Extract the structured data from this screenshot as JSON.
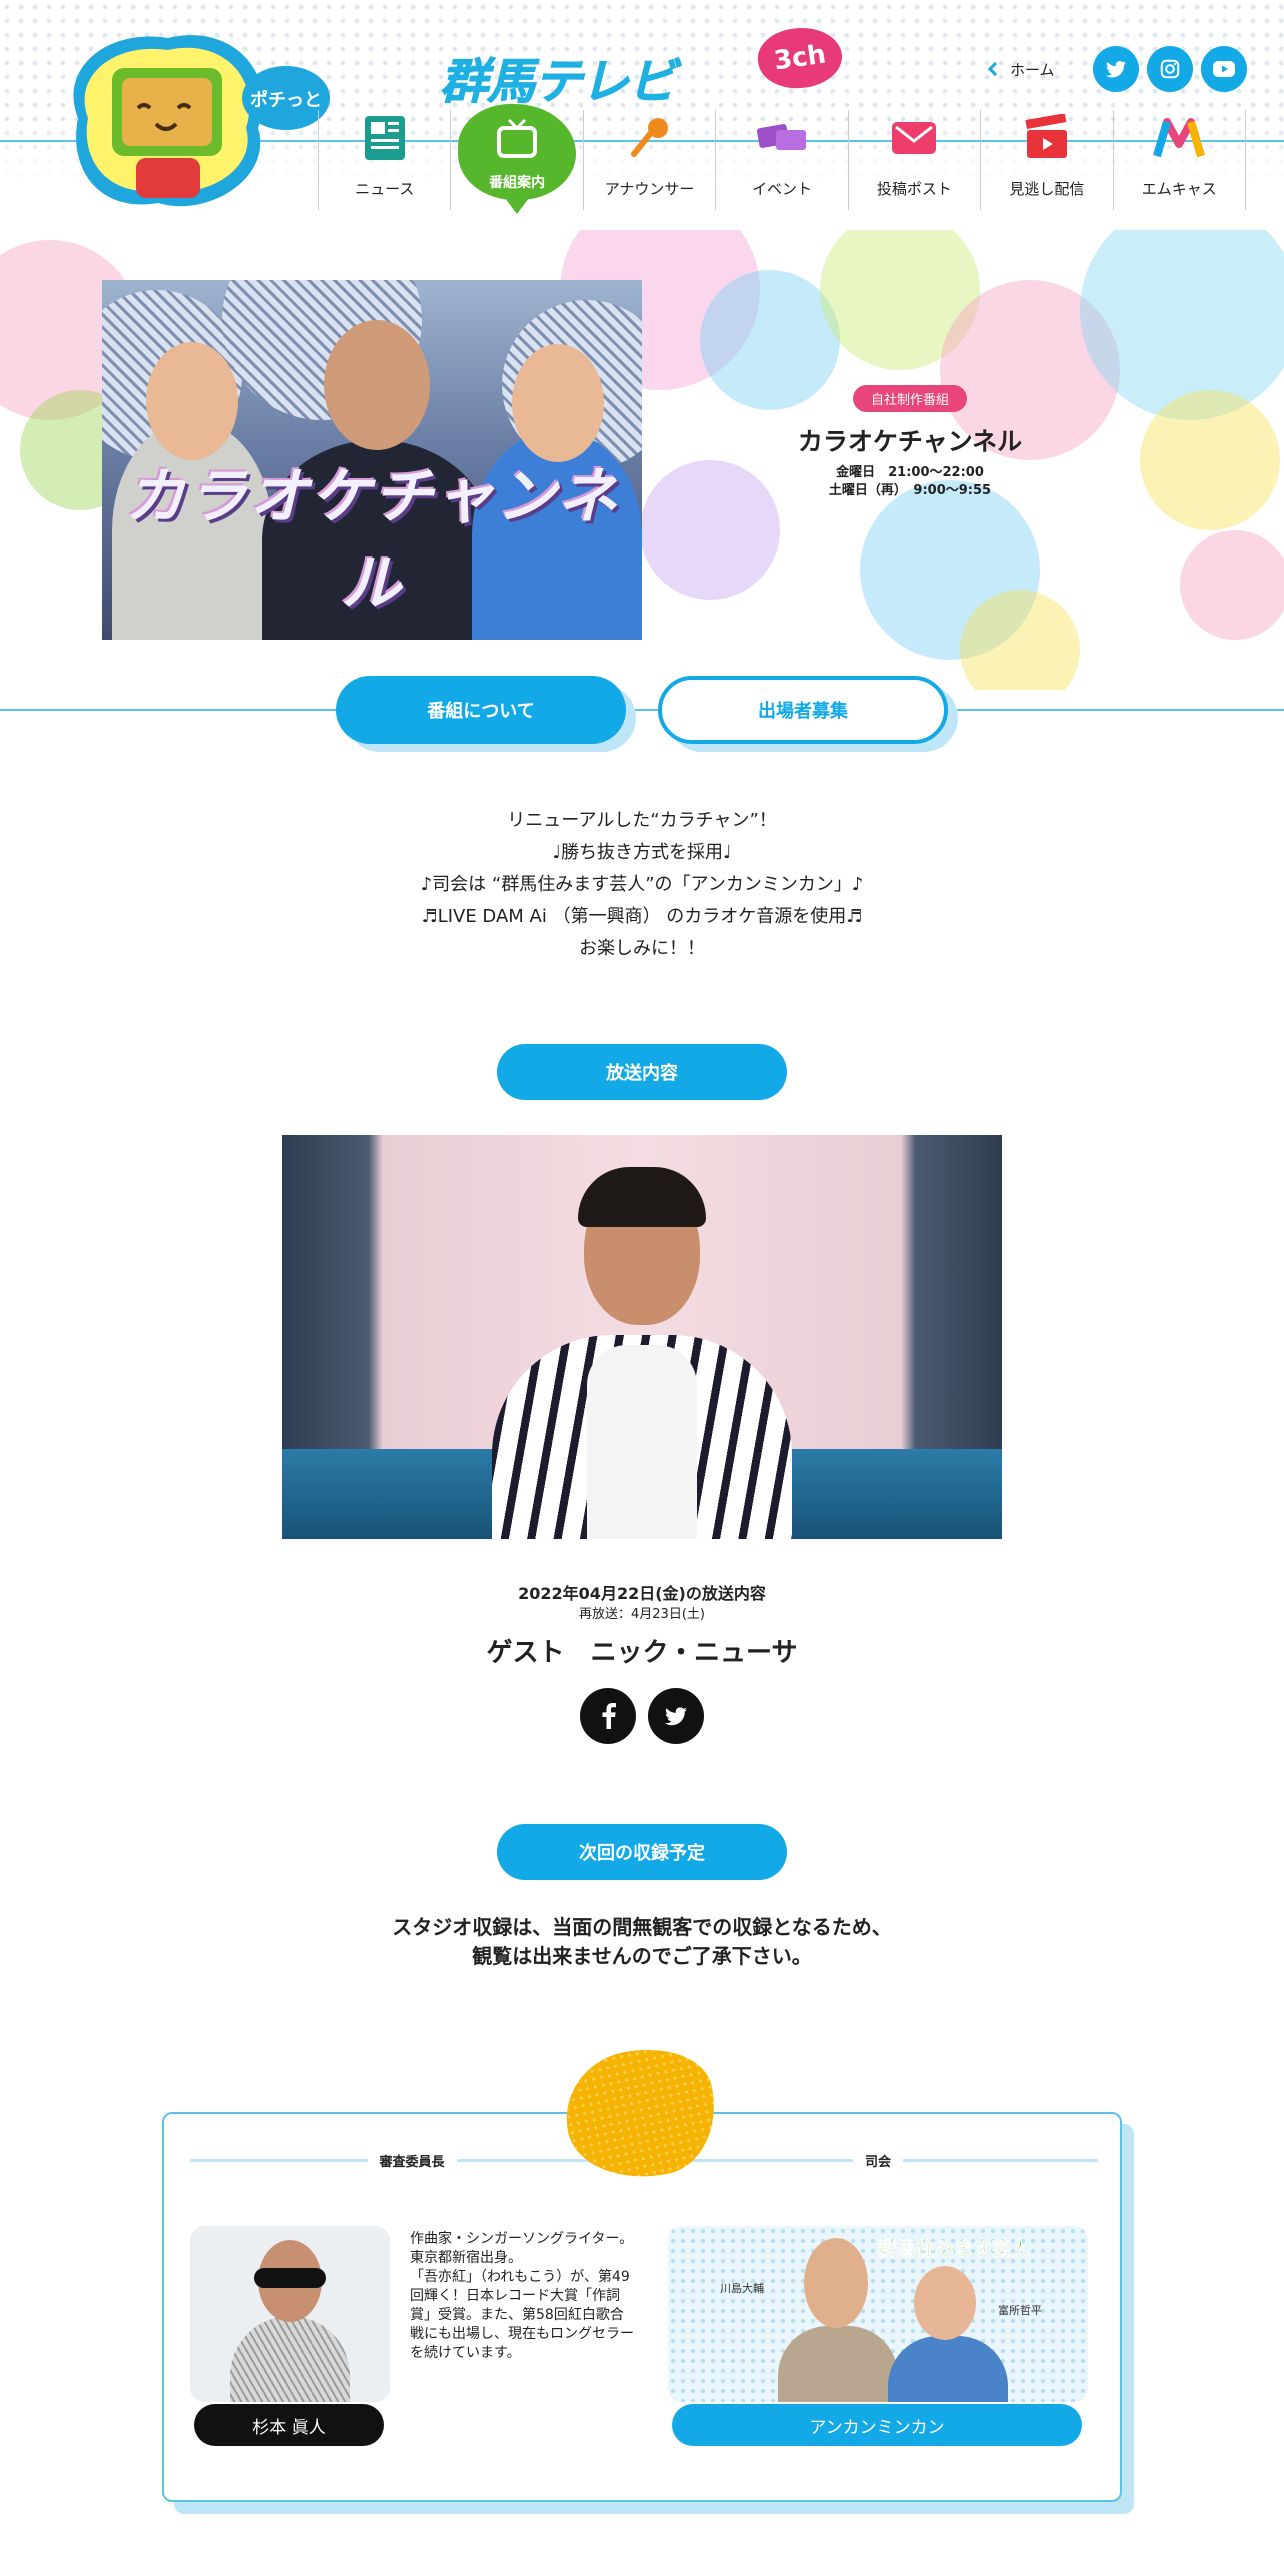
{
  "header": {
    "mascot_text": "ポチっと",
    "logo_main": "群馬テレビ",
    "logo_channel": "3ch",
    "home_label": "ホーム",
    "sns": [
      {
        "icon": "twitter-icon"
      },
      {
        "icon": "instagram-icon"
      },
      {
        "icon": "youtube-icon"
      }
    ],
    "nav": [
      {
        "label": "ニュース",
        "icon": "news-icon"
      },
      {
        "label": "番組案内",
        "icon": "tv-icon",
        "active": true
      },
      {
        "label": "アナウンサー",
        "icon": "microphone-icon"
      },
      {
        "label": "イベント",
        "icon": "ticket-icon"
      },
      {
        "label": "投稿ポスト",
        "icon": "mail-icon"
      },
      {
        "label": "見逃し配信",
        "icon": "clapperboard-icon"
      },
      {
        "label": "エムキャス",
        "icon": "mcas-icon"
      }
    ]
  },
  "program": {
    "hero_title": "カラオケチャンネル",
    "badge": "自社制作番組",
    "title": "カラオケチャンネル",
    "schedule_1": "金曜日　21:00～22:00",
    "schedule_2": "土曜日（再）　9:00～9:55"
  },
  "tabs": [
    {
      "label": "番組について"
    },
    {
      "label": "出場者募集"
    }
  ],
  "intro": [
    "リニューアルした“カラチャン”！",
    "♩勝ち抜き方式を採用♩",
    "♪司会は “群馬住みます芸人”の「アンカンミンカン」♪",
    "♬LIVE DAM Ai （第一興商） のカラオケ音源を使用♬",
    "お楽しみに！！"
  ],
  "broadcast": {
    "section_label": "放送内容",
    "date": "2022年04月22日(金)の放送内容",
    "rerun": "再放送：4月23日(土)",
    "guest": "ゲスト　ニック・ニューサ"
  },
  "share": [
    {
      "icon": "facebook-icon"
    },
    {
      "icon": "twitter-icon"
    }
  ],
  "recording": {
    "section_label": "次回の収録予定",
    "notice_1": "スタジオ収録は、当面の間無観客での収録となるため、",
    "notice_2": "観覧は出来ませんのでご了承下さい。"
  },
  "cast": {
    "judge": {
      "role": "審査委員長",
      "name": "杉本 眞人",
      "bio": "作曲家・シンガーソングライター。\n東京都新宿出身。\n「吾亦紅」（われもこう）が、第49回輝く！日本レコード大賞「作詞賞」受賞。また、第58回紅白歌合戦にも出場し、現在もロングセラーを続けています。"
    },
    "host": {
      "role": "司会",
      "name": "アンカンミンカン",
      "photo_caption": "群馬住みます芸人",
      "member_1": "川島大輔",
      "member_2": "富所哲平"
    }
  },
  "colors": {
    "accent": "#12a9e6",
    "pink": "#e8457a",
    "green": "#56b62c",
    "yellow": "#f6b400"
  }
}
